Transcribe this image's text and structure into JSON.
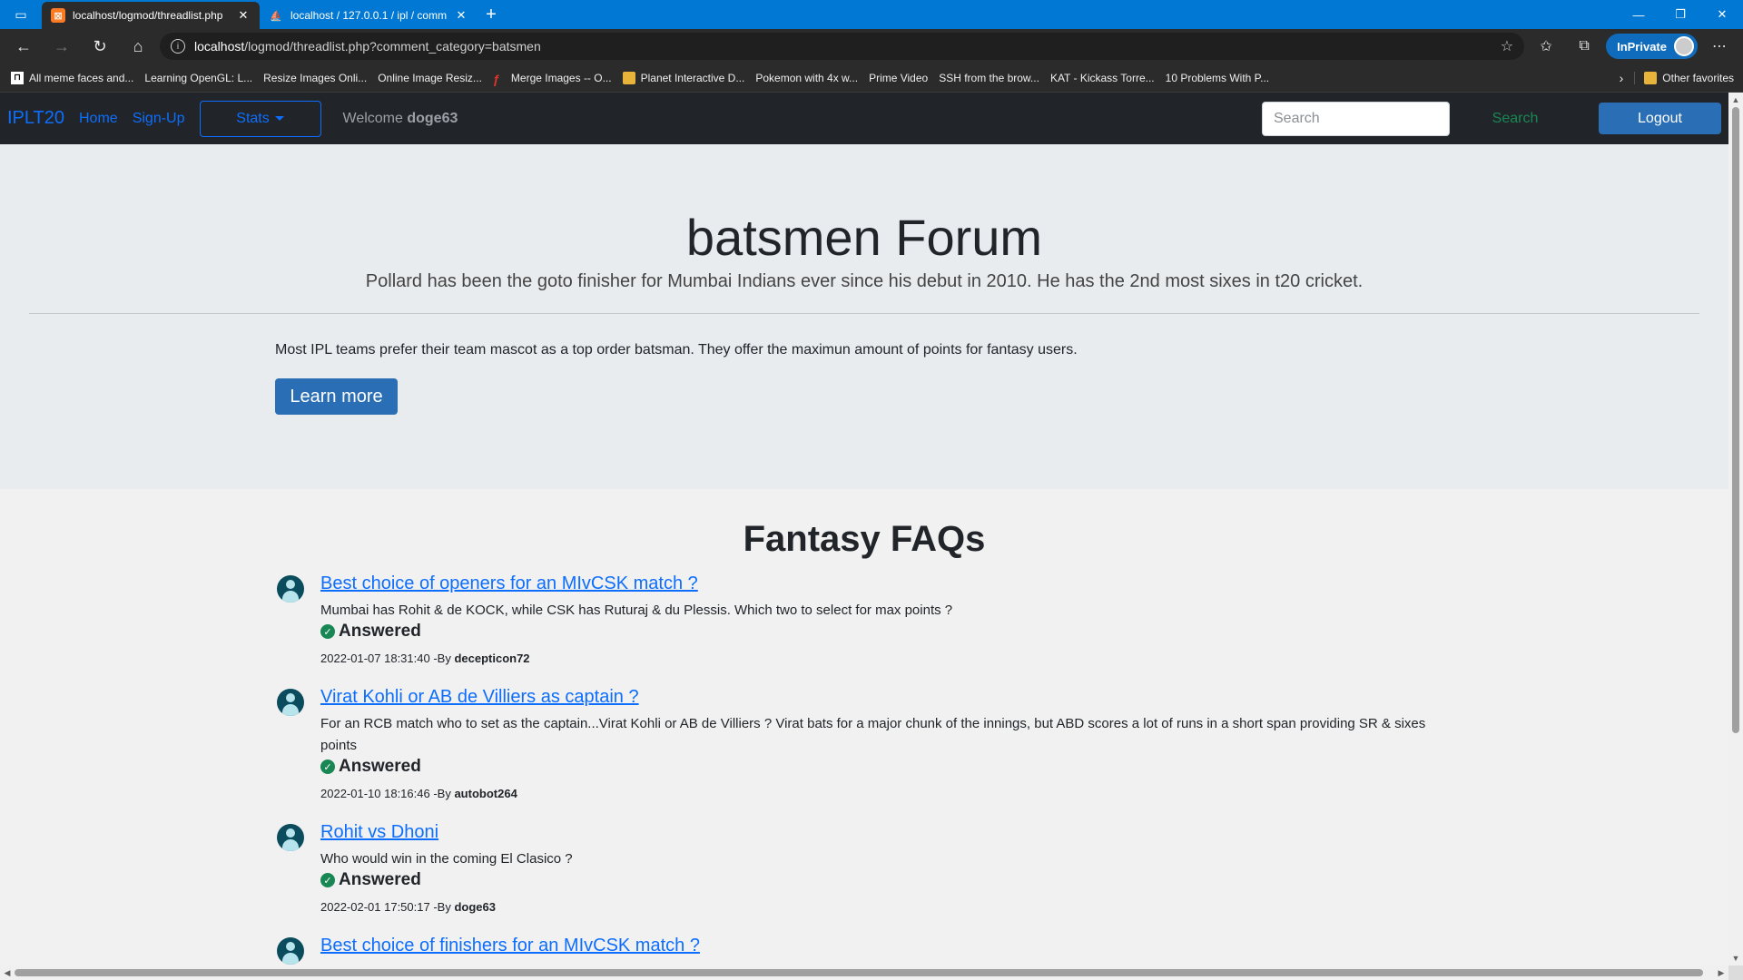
{
  "browser": {
    "tabs": [
      {
        "title": "localhost/logmod/threadlist.php",
        "favicon": "xampp-icon",
        "active": true
      },
      {
        "title": "localhost / 127.0.0.1 / ipl / comm",
        "favicon": "phpmyadmin-icon",
        "active": false
      }
    ],
    "url_host": "localhost",
    "url_path": "/logmod/threadlist.php?comment_category=batsmen",
    "inprivate_label": "InPrivate",
    "bookmarks": [
      {
        "label": "All meme faces and...",
        "icon": "meme-icon"
      },
      {
        "label": "Learning OpenGL: L...",
        "icon": "page-icon"
      },
      {
        "label": "Resize Images Onli...",
        "icon": "page-icon"
      },
      {
        "label": "Online Image Resiz...",
        "icon": "page-icon"
      },
      {
        "label": "Merge Images -- O...",
        "icon": "red-f-icon"
      },
      {
        "label": "Planet Interactive D...",
        "icon": "folder-icon"
      },
      {
        "label": "Pokemon with 4x w...",
        "icon": "page-icon"
      },
      {
        "label": "Prime Video",
        "icon": "page-icon"
      },
      {
        "label": "SSH from the brow...",
        "icon": "page-icon"
      },
      {
        "label": "KAT - Kickass Torre...",
        "icon": "page-icon"
      },
      {
        "label": "10 Problems With P...",
        "icon": "page-icon"
      }
    ],
    "other_favorites": "Other favorites"
  },
  "nav": {
    "brand": "IPLT20",
    "home": "Home",
    "signup": "Sign-Up",
    "stats": "Stats",
    "welcome_prefix": "Welcome ",
    "username": "doge63",
    "search_placeholder": "Search",
    "search_button": "Search",
    "logout": "Logout"
  },
  "jumbotron": {
    "title": "batsmen Forum",
    "lead": "Pollard has been the goto finisher for Mumbai Indians ever since his debut in 2010. He has the 2nd most sixes in t20 cricket.",
    "description": "Most IPL teams prefer their team mascot as a top order batsman. They offer the maximun amount of points for fantasy users.",
    "learn_more": "Learn more"
  },
  "faq": {
    "heading": "Fantasy FAQs",
    "threads": [
      {
        "title": "Best choice of openers for an MIvCSK match ?",
        "description": "Mumbai has Rohit & de KOCK, while CSK has Ruturaj & du Plessis. Which two to select for max points ?",
        "status": "Answered",
        "timestamp": "2022-01-07 18:31:40",
        "by": " -By ",
        "author": "decepticon72"
      },
      {
        "title": "Virat Kohli or AB de Villiers as captain ?",
        "description": "For an RCB match who to set as the captain...Virat Kohli or AB de Villiers ? Virat bats for a major chunk of the innings, but ABD scores a lot of runs in a short span providing SR & sixes points",
        "status": "Answered",
        "timestamp": "2022-01-10 18:16:46",
        "by": " -By ",
        "author": "autobot264"
      },
      {
        "title": "Rohit vs Dhoni",
        "description": "Who would win in the coming El Clasico ?",
        "status": "Answered",
        "timestamp": "2022-02-01 17:50:17",
        "by": " -By ",
        "author": "doge63"
      },
      {
        "title": "Best choice of finishers for an MIvCSK match ?"
      }
    ]
  }
}
